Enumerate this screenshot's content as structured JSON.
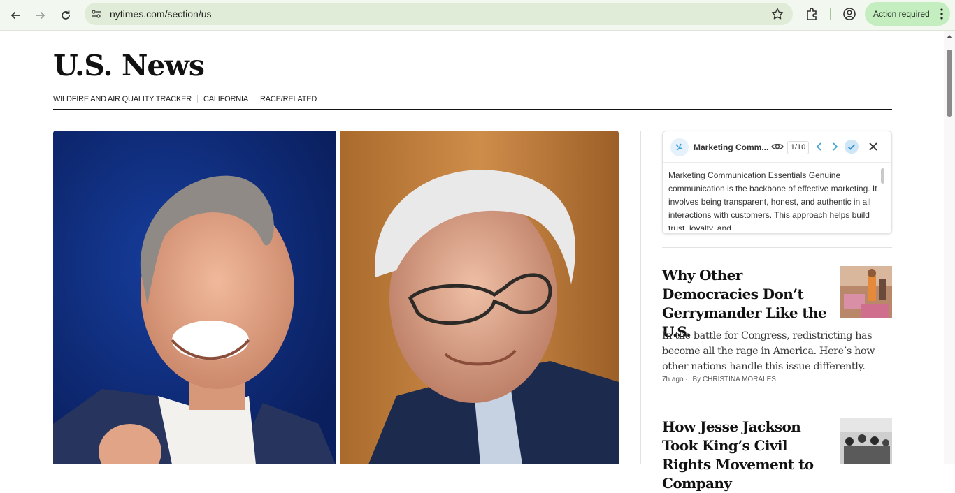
{
  "browser": {
    "url": "nytimes.com/section/us",
    "action_label": "Action required"
  },
  "page": {
    "title": "U.S. News",
    "subnav": [
      "WILDFIRE AND AIR QUALITY TRACKER",
      "CALIFORNIA",
      "RACE/RELATED"
    ]
  },
  "popup": {
    "title": "Marketing Comm...",
    "counter": "1/10",
    "body": "Marketing Communication Essentials Genuine communication is the backbone of effective marketing. It involves being transparent, honest, and authentic in all interactions with customers. This approach helps build trust, loyalty, and"
  },
  "stories": [
    {
      "headline": "Why Other Democracies Don’t Gerrymander Like the U.S.",
      "summary": "In the battle for Congress, redistricting has become all the rage in America. Here’s how other nations handle this issue differently.",
      "time": "7h ago",
      "byline": "By CHRISTINA MORALES"
    },
    {
      "headline": "How Jesse Jackson Took King’s Civil Rights Movement to Company"
    }
  ]
}
